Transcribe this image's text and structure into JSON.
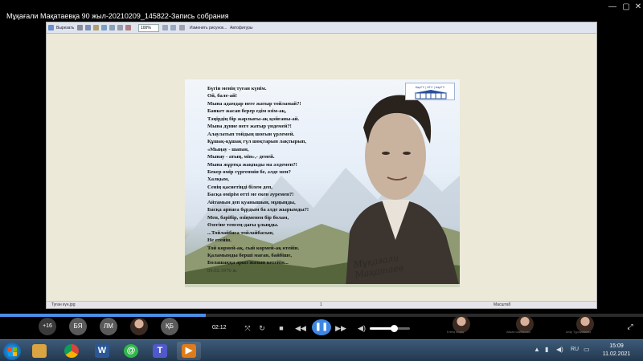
{
  "window": {
    "title": "Мұқағали Мақатаевқа 90 жыл-20210209_145822-Запись собрания"
  },
  "document_viewer": {
    "toolbar": {
      "edit_label": "Вырезать",
      "zoom_value": "100%",
      "change_picture_label": "Изменить рисунок...",
      "autofigure_label": "Автофигуры"
    },
    "status_left": "Туған күн.jpg",
    "status_page": "1",
    "status_zoom_label": "Масштаб"
  },
  "poster": {
    "logo_text": "КарГУ | КГУ | КарГУ",
    "poem_lines": [
      "Бүгін менің туған күнім.",
      "Ой, бале-ай!",
      "Мына адамдар неге жатыр тойламай?!",
      "Банкет жасап берер едім өзім-ақ,",
      "Тәңірдің бір жарлығы-ақ қойғаны-ай.",
      "Мына дүние неге жатыр үндемей?!",
      "Алаулатып тойдың шоғын үрлемей.",
      "Құшақ-құшақ гүл шоқтарын лақтырып,",
      "«Мыңау - шапан,",
      "Мынау - атың, мін»,- демей.",
      "Мына жұртқа жақпады ма әлдемен?!",
      "Бекер өмір сүргенмін бе, әлде мен?",
      "Халқым,",
      "Сенің қасиетіңді білем деп,",
      "Басқа өмірім өтті ме екен әуремен?!",
      "Айтамын деп қуанышын, мұңыңды,",
      "Басқа арнаға бұрдым ба әлде жырымды?!",
      "Мен, бәрібір, өзіңменен бір болам,",
      "Өзегіне тепсең-дағы ұлыңды.",
      "...Тойлайбаса тойлайбасын,",
      "Не етейін.",
      "Той көрмей-ақ, сый көрмей-ақ өтейін.",
      "Қаламымды берші маған, байбіше,",
      "Болашаққа арыз жазып кетейін..."
    ],
    "date": "09.02.1976 ж.",
    "signature": "Мұқағали Мақатаев"
  },
  "player": {
    "progress_fraction": 0.32,
    "time": "02:12",
    "volume_fraction": 0.6,
    "participants": [
      {
        "label": "+16",
        "kind": "more"
      },
      {
        "label": "БЯ",
        "kind": "initials"
      },
      {
        "label": "ЛМ",
        "kind": "initials"
      },
      {
        "label": "",
        "kind": "photo"
      },
      {
        "label": "ҚБ",
        "kind": "initials"
      }
    ],
    "right_tiles": [
      {
        "label": "Елена Ысқақ"
      },
      {
        "label": "Айжан Шайбатова"
      },
      {
        "label": "Анар Тұрсымбаева"
      }
    ]
  },
  "taskbar": {
    "apps": [
      {
        "name": "explorer",
        "color": "#d9a441",
        "glyph": ""
      },
      {
        "name": "chrome",
        "color": "#e0e0e0",
        "glyph": ""
      },
      {
        "name": "word",
        "color": "#2b5797",
        "glyph": "W"
      },
      {
        "name": "whatsapp",
        "color": "#2fb84a",
        "glyph": "@"
      },
      {
        "name": "teams",
        "color": "#5059c9",
        "glyph": "T"
      },
      {
        "name": "media-player",
        "color": "#e07b1a",
        "glyph": "▶"
      }
    ],
    "tray_label": "RU",
    "clock_time": "15:09",
    "clock_date": "11.02.2021"
  }
}
